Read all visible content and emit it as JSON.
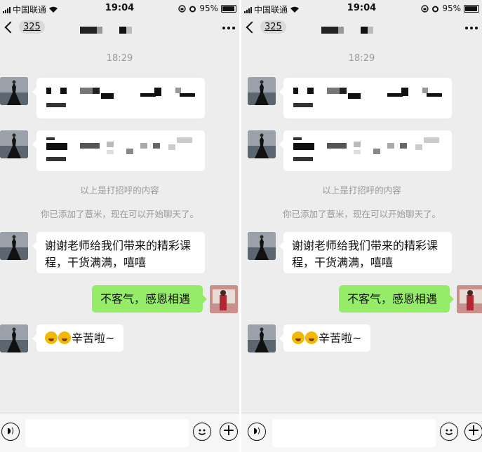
{
  "status_bar": {
    "carrier": "中国联通",
    "time": "19:04",
    "battery": "95%"
  },
  "nav": {
    "back_count": "325"
  },
  "chat": {
    "timestamp": "18:29",
    "greeting_note": "以上是打招呼的内容",
    "added_note": "你已添加了薏米，现在可以开始聊天了。",
    "messages": [
      {
        "from": "other",
        "text": "谢谢老师给我们带来的精彩课程，干货满满，嘻嘻"
      },
      {
        "from": "self",
        "text": "不客气，感恩相遇"
      },
      {
        "from": "other",
        "text": "辛苦啦~"
      }
    ]
  },
  "icons": {
    "voice": "voice-icon",
    "emoji": "emoji-icon",
    "plus": "plus-icon",
    "more": "more-icon",
    "wifi": "wifi-icon",
    "alarm": "alarm-icon"
  },
  "colors": {
    "chat_bg": "#ededed",
    "self_bubble": "#95ec69",
    "other_bubble": "#ffffff",
    "system_text": "#9a9a9a"
  }
}
